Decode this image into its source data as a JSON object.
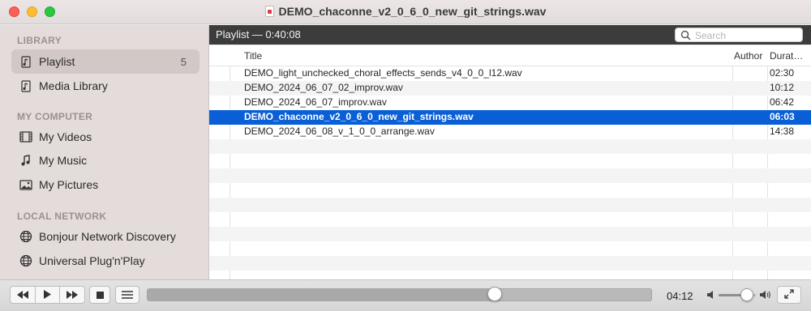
{
  "window": {
    "title": "DEMO_chaconne_v2_0_6_0_new_git_strings.wav",
    "title_icon": "audio-file-icon"
  },
  "sidebar": {
    "sections": [
      {
        "label": "LIBRARY",
        "items": [
          {
            "label": "Playlist",
            "icon": "playlist-icon",
            "count": "5",
            "selected": true
          },
          {
            "label": "Media Library",
            "icon": "media-library-icon",
            "count": "",
            "selected": false
          }
        ]
      },
      {
        "label": "MY COMPUTER",
        "items": [
          {
            "label": "My Videos",
            "icon": "film-icon"
          },
          {
            "label": "My Music",
            "icon": "music-note-icon"
          },
          {
            "label": "My Pictures",
            "icon": "picture-icon"
          }
        ]
      },
      {
        "label": "LOCAL NETWORK",
        "items": [
          {
            "label": "Bonjour Network Discovery",
            "icon": "network-globe-icon"
          },
          {
            "label": "Universal Plug'n'Play",
            "icon": "network-globe-icon"
          }
        ]
      }
    ]
  },
  "playlist": {
    "header": "Playlist — 0:40:08",
    "search_placeholder": "Search",
    "columns": {
      "title": "Title",
      "author": "Author",
      "duration": "Durat…"
    },
    "rows": [
      {
        "title": "DEMO_light_unchecked_choral_effects_sends_v4_0_0_l12.wav",
        "author": "",
        "duration": "02:30",
        "selected": false
      },
      {
        "title": "DEMO_2024_06_07_02_improv.wav",
        "author": "",
        "duration": "10:12",
        "selected": false
      },
      {
        "title": "DEMO_2024_06_07_improv.wav",
        "author": "",
        "duration": "06:42",
        "selected": false
      },
      {
        "title": "DEMO_chaconne_v2_0_6_0_new_git_strings.wav",
        "author": "",
        "duration": "06:03",
        "selected": true
      },
      {
        "title": "DEMO_2024_06_08_v_1_0_0_arrange.wav",
        "author": "",
        "duration": "14:38",
        "selected": false
      }
    ]
  },
  "controls": {
    "current_time": "04:12",
    "progress": 0.69,
    "volume": 0.75,
    "accent": "#0a5fd6"
  }
}
